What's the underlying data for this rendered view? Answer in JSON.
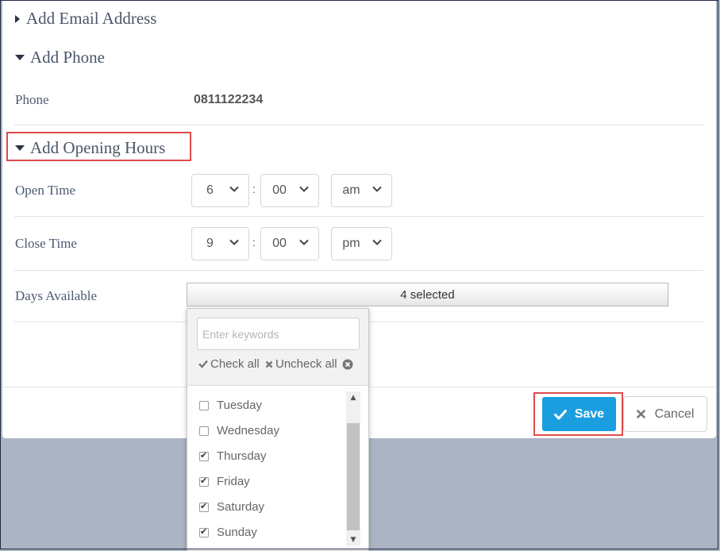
{
  "sections": {
    "email": {
      "label": "Add Email Address"
    },
    "phone": {
      "label": "Add Phone",
      "field_label": "Phone",
      "field_value": "0811122234"
    },
    "hours": {
      "label": "Add Opening Hours"
    }
  },
  "open_time": {
    "label": "Open Time",
    "hour": "6",
    "minute": "00",
    "ampm": "am"
  },
  "close_time": {
    "label": "Close Time",
    "hour": "9",
    "minute": "00",
    "ampm": "pm"
  },
  "days": {
    "label": "Days Available",
    "summary": "4 selected",
    "search_placeholder": "Enter keywords",
    "check_all": "Check all",
    "uncheck_all": "Uncheck all",
    "items": [
      {
        "label": "Tuesday",
        "checked": false
      },
      {
        "label": "Wednesday",
        "checked": false
      },
      {
        "label": "Thursday",
        "checked": true
      },
      {
        "label": "Friday",
        "checked": true
      },
      {
        "label": "Saturday",
        "checked": true
      },
      {
        "label": "Sunday",
        "checked": true
      }
    ]
  },
  "footer": {
    "save_label": "Save",
    "cancel_label": "Cancel"
  },
  "colors": {
    "accent": "#1a9ee0",
    "highlight": "#e04b4b",
    "backdrop": "#aab4c3"
  },
  "icons": [
    "caret-right-icon",
    "caret-down-icon",
    "chevron-down-icon",
    "check-icon",
    "close-icon",
    "clear-circle-icon",
    "scroll-up-icon",
    "scroll-down-icon"
  ]
}
